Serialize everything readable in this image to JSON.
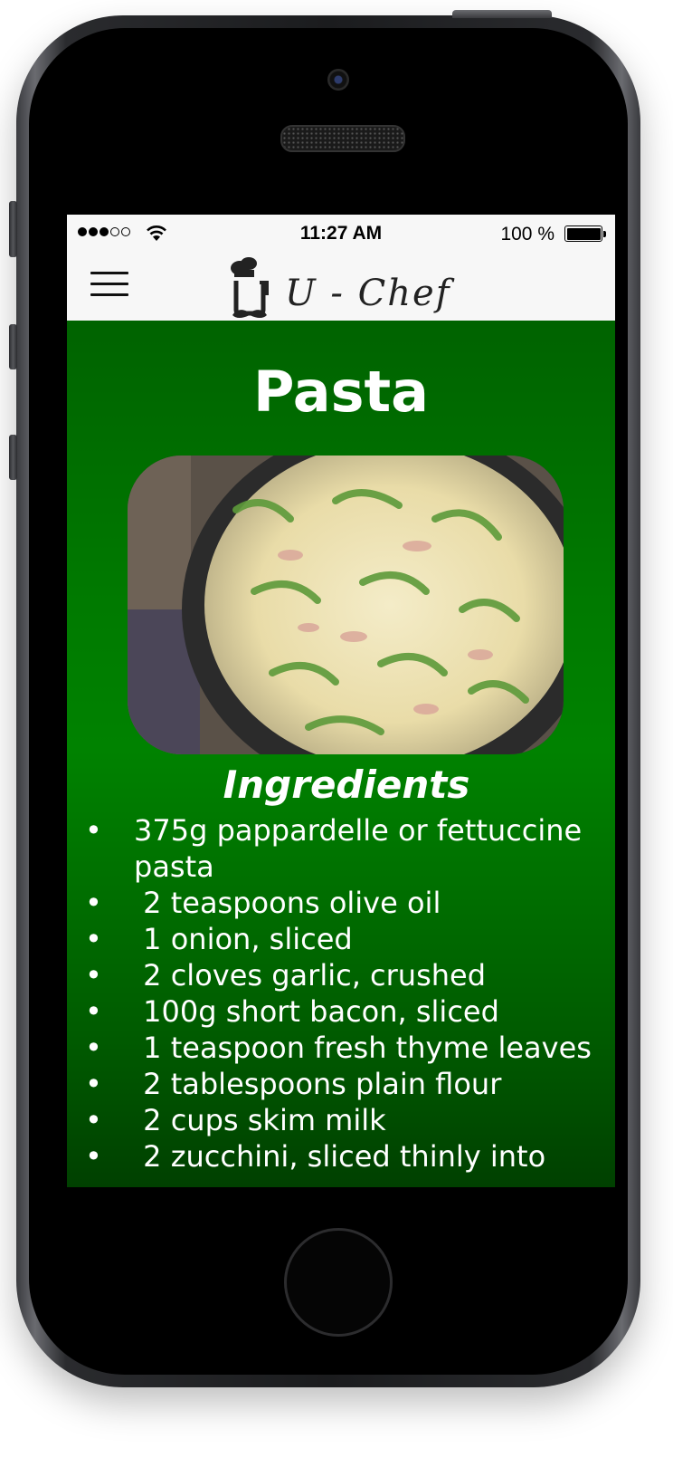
{
  "status_bar": {
    "time": "11:27 AM",
    "battery": "100 %",
    "signal_strength": "3 of 5"
  },
  "nav": {
    "app_title": "U - Chef",
    "menu_icon": "hamburger-icon",
    "logo_icon": "chef-mustache-icon"
  },
  "recipe": {
    "title": "Pasta",
    "image_alt": "pasta-dish-photo",
    "ingredients_heading": "Ingredients",
    "ingredients": [
      "375g pappardelle or fettuccine pasta",
      " 2 teaspoons olive oil",
      " 1 onion, sliced",
      " 2 cloves garlic, crushed",
      " 100g short bacon, sliced",
      " 1 teaspoon fresh thyme leaves",
      " 2 tablespoons plain flour",
      " 2 cups skim milk",
      " 2 zucchini, sliced thinly into"
    ],
    "bullet": "•"
  },
  "colors": {
    "background_green": "#007a00",
    "bar_background": "#f7f7f7",
    "text": "#ffffff"
  }
}
